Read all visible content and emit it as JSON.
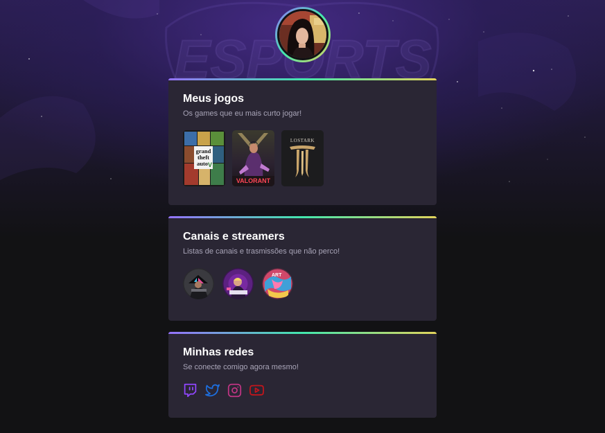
{
  "games_section": {
    "title": "Meus jogos",
    "subtitle": "Os games que eu mais curto jogar!",
    "games": [
      {
        "name": "GTA V",
        "lines": [
          "grand",
          "theft",
          "auto"
        ],
        "badge": "V"
      },
      {
        "name": "Valorant",
        "label": "VALORANT"
      },
      {
        "name": "Lost Ark",
        "label": "LOSTARK"
      }
    ]
  },
  "channels_section": {
    "title": "Canais e streamers",
    "subtitle": "Listas de canais e trasmissões que não perco!",
    "channels": [
      {
        "name": "channel-1"
      },
      {
        "name": "channel-2"
      },
      {
        "name": "channel-3",
        "label": "ART"
      }
    ]
  },
  "socials_section": {
    "title": "Minhas redes",
    "subtitle": "Se conecte comigo agora mesmo!",
    "links": [
      {
        "icon": "twitch-icon",
        "color": "#9146ff"
      },
      {
        "icon": "twitter-icon",
        "color": "#1d6fe0"
      },
      {
        "icon": "instagram-icon",
        "color": "#c13584"
      },
      {
        "icon": "youtube-icon",
        "color": "#c4161c"
      }
    ]
  },
  "background": {
    "watermark": "ESPORTS",
    "accent_gradient": [
      "#9572fc",
      "#43e7ad",
      "#e2d45c"
    ]
  }
}
